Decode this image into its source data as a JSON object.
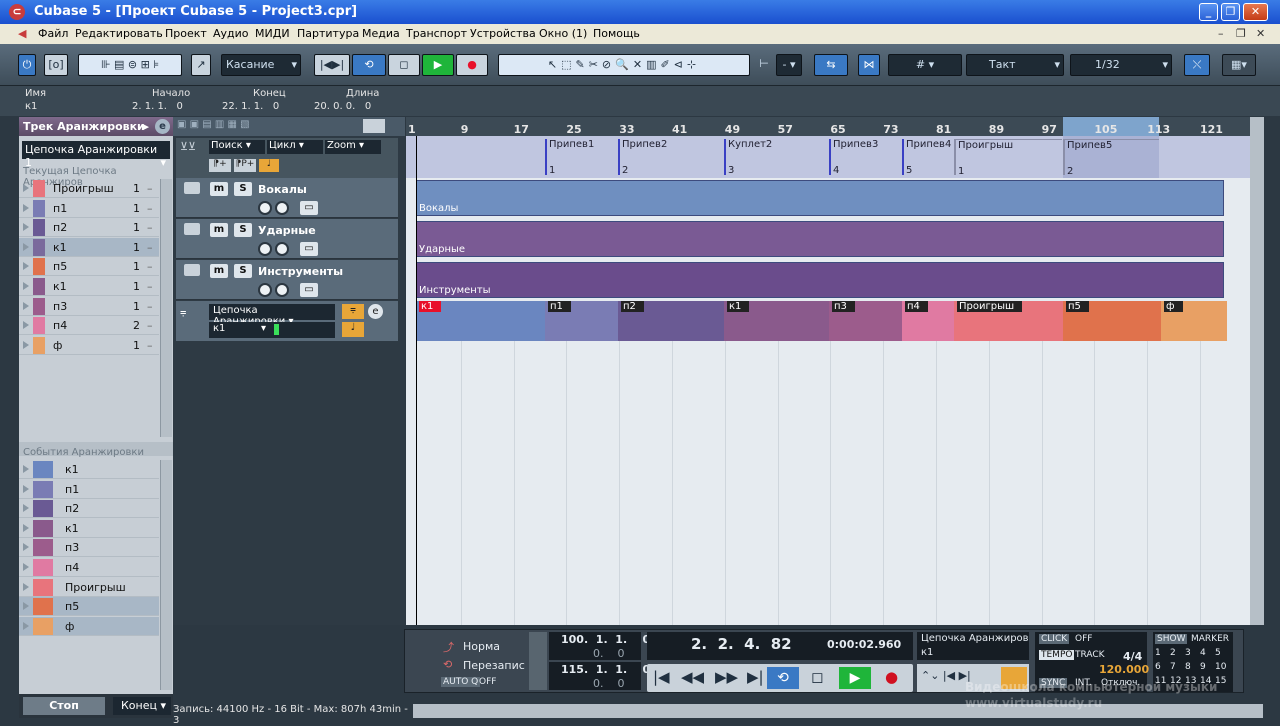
{
  "window": {
    "title": "Cubase 5 - [Проект Cubase 5 - Project3.cpr]"
  },
  "menu": [
    "Файл",
    "Редактировать",
    "Проект",
    "Аудио",
    "МИДИ",
    "Партитура",
    "Медиа",
    "Транспорт",
    "Устройства",
    "Окно (1)",
    "Помощь"
  ],
  "toolbar": {
    "touch_mode": "Касание",
    "snap_type": "Такт",
    "quantize": "1/32",
    "dash": "-"
  },
  "infoline": {
    "name_label": "Имя",
    "name_value": "к1",
    "start_label": "Начало",
    "start_value": "2. 1. 1.   0",
    "end_label": "Конец",
    "end_value": "22. 1. 1.   0",
    "length_label": "Длина",
    "length_value": "20. 0. 0.   0"
  },
  "inspector": {
    "title": "Трек Аранжировки",
    "chain": "Цепочка Аранжировки 1",
    "current_chain_label": "Текущая Цепочка Аранжиров",
    "chain_items": [
      {
        "name": "Проигрыш",
        "repeats": "1",
        "color": "#e8747c"
      },
      {
        "name": "п1",
        "repeats": "1",
        "color": "#7a7cb4"
      },
      {
        "name": "п2",
        "repeats": "1",
        "color": "#6a5a94"
      },
      {
        "name": "к1",
        "repeats": "1",
        "color": "#7a6a9c"
      },
      {
        "name": "п5",
        "repeats": "1",
        "color": "#e0724c"
      },
      {
        "name": "к1",
        "repeats": "1",
        "color": "#8a5a8c"
      },
      {
        "name": "п3",
        "repeats": "1",
        "color": "#9c5c8c"
      },
      {
        "name": "п4",
        "repeats": "2",
        "color": "#e07aa2"
      },
      {
        "name": "ф",
        "repeats": "1",
        "color": "#e8a064"
      }
    ],
    "events_label": "События Аранжировки",
    "events": [
      {
        "name": "к1",
        "color": "#6a86c0"
      },
      {
        "name": "п1",
        "color": "#7a7cb4"
      },
      {
        "name": "п2",
        "color": "#6a5a94"
      },
      {
        "name": "к1",
        "color": "#8a5a8c"
      },
      {
        "name": "п3",
        "color": "#9c5c8c"
      },
      {
        "name": "п4",
        "color": "#e07aa2"
      },
      {
        "name": "Проигрыш",
        "color": "#e8747c"
      },
      {
        "name": "п5",
        "color": "#e0724c"
      },
      {
        "name": "ф",
        "color": "#e8a064"
      }
    ],
    "stop_label": "Стоп",
    "end_label": "Конец"
  },
  "tracklist": {
    "search": "Поиск",
    "cycle": "Цикл",
    "zoom": "Zoom",
    "tracks": [
      {
        "name": "Вокалы",
        "m": "m",
        "s": "S"
      },
      {
        "name": "Ударные",
        "m": "m",
        "s": "S"
      },
      {
        "name": "Инструменты",
        "m": "m",
        "s": "S"
      }
    ],
    "arranger_chain": "Цепочка Аранжировки",
    "arranger_current": "к1"
  },
  "ruler": [
    "1",
    "9",
    "17",
    "25",
    "33",
    "41",
    "49",
    "57",
    "65",
    "73",
    "81",
    "89",
    "97",
    "105",
    "113",
    "121"
  ],
  "markers": [
    {
      "label": "Припев1",
      "num": "1"
    },
    {
      "label": "Припев2",
      "num": "2"
    },
    {
      "label": "Куплет2",
      "num": "3"
    },
    {
      "label": "Припев3",
      "num": "4"
    },
    {
      "label": "Припев4",
      "num": "5"
    },
    {
      "label": "Проигрыш",
      "num": "1"
    },
    {
      "label": "Припев5",
      "num": "2"
    }
  ],
  "lanes": [
    {
      "label": "Вокалы",
      "color": "#6f8fc0"
    },
    {
      "label": "Ударные",
      "color": "#7a5a94"
    },
    {
      "label": "Инструменты",
      "color": "#6a4c8c"
    }
  ],
  "segments": [
    {
      "label": "к1",
      "color": "#6a86c0"
    },
    {
      "label": "п1",
      "color": "#7a7cb4"
    },
    {
      "label": "п2",
      "color": "#6a5a94"
    },
    {
      "label": "к1",
      "color": "#8a5a8c"
    },
    {
      "label": "п3",
      "color": "#9c5c8c"
    },
    {
      "label": "п4",
      "color": "#e07aa2"
    },
    {
      "label": "Проигрыш",
      "color": "#e8747c"
    },
    {
      "label": "п5",
      "color": "#e0724c"
    },
    {
      "label": "ф",
      "color": "#e8a064"
    }
  ],
  "transport": {
    "mode1": "Норма",
    "mode2": "Перезапис",
    "auto_q": "AUTO Q",
    "off": "OFF",
    "left_locator": "100.  1.  1.    0",
    "right_locator": "115.  1.  1.    0",
    "zero": "0.    0",
    "position": "2.  2.  4.  82",
    "time": "0:00:02.960",
    "chain": "Цепочка Аранжиров",
    "chain_current": "к1",
    "click": "CLICK",
    "click_state": "OFF",
    "tempo": "TEMPO",
    "track": "TRACK",
    "signature": "4/4",
    "tempo_value": "120.000",
    "sync": "SYNC",
    "int": "INT.",
    "offline": "Отключ.",
    "show": "SHOW",
    "marker": "MARKER",
    "marker_nums": [
      "1",
      "2",
      "3",
      "4",
      "5",
      "6",
      "7",
      "8",
      "9",
      "10",
      "11",
      "12",
      "13",
      "14",
      "15"
    ]
  },
  "status": "Запись: 44100 Hz - 16 Bit - Max: 807h 43min - 3",
  "watermark": [
    "Видеошкола компьютерной музыки",
    "www.virtualstudy.ru"
  ]
}
